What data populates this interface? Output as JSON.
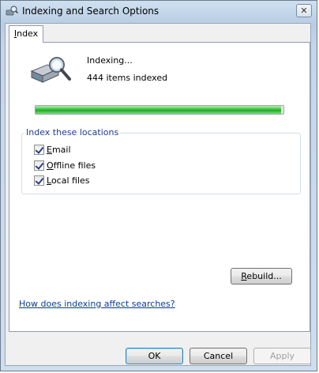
{
  "window": {
    "title": "Indexing and Search Options",
    "close_label": "✕"
  },
  "tabs": [
    {
      "label": "Index",
      "accel": "I",
      "rest": "ndex"
    }
  ],
  "status": {
    "line1": "Indexing...",
    "line2": "444 items indexed",
    "progress_fraction": 0.99
  },
  "locations": {
    "legend": "Index these locations",
    "items": [
      {
        "label": "Email",
        "accel": "E",
        "rest": "mail",
        "checked": true
      },
      {
        "label": "Offline files",
        "accel": "O",
        "rest": "ffline files",
        "checked": true
      },
      {
        "label": "Local files",
        "accel": "L",
        "rest": "ocal files",
        "checked": true
      }
    ]
  },
  "buttons": {
    "rebuild": {
      "accel": "R",
      "rest": "ebuild..."
    },
    "ok": "OK",
    "cancel": "Cancel",
    "apply": "Apply"
  },
  "help_link": "How does indexing affect searches?",
  "colors": {
    "link": "#0b3b9a",
    "progress": "#1da51f",
    "legend": "#1d3c8a"
  }
}
